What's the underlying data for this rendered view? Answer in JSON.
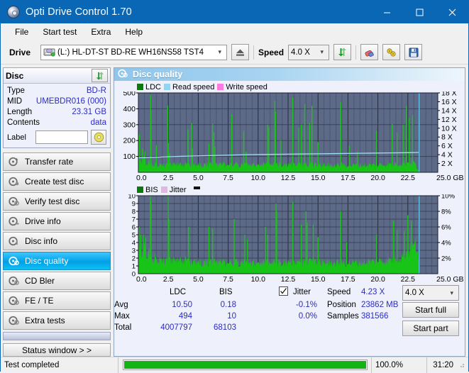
{
  "window": {
    "title": "Opti Drive Control 1.70",
    "icon": "disc-icon",
    "minimize": "—",
    "maximize": "☐",
    "close": "✕"
  },
  "menu": {
    "items": [
      "File",
      "Start test",
      "Extra",
      "Help"
    ]
  },
  "toolbar": {
    "drive_label": "Drive",
    "drive_value": "(L:)  HL-DT-ST BD-RE  WH16NS58 TST4",
    "eject_icon": "eject-icon",
    "speed_label": "Speed",
    "speed_value": "4.0 X",
    "refresh_icon": "refresh-icon",
    "erase_icon": "eraser-icon",
    "tools_icon": "tools-icon",
    "save_icon": "save-icon"
  },
  "disc": {
    "title": "Disc",
    "refresh_icon": "refresh-icon",
    "rows": [
      {
        "key": "Type",
        "value": "BD-R"
      },
      {
        "key": "MID",
        "value": "UMEBDR016 (000)"
      },
      {
        "key": "Length",
        "value": "23.31 GB"
      },
      {
        "key": "Contents",
        "value": "data"
      }
    ],
    "label_key": "Label",
    "label_value": "",
    "label_button_icon": "disc-label-icon"
  },
  "sidebar": {
    "items": [
      {
        "label": "Transfer rate",
        "icon": "disc-test-icon",
        "active": false
      },
      {
        "label": "Create test disc",
        "icon": "disc-test-icon",
        "active": false
      },
      {
        "label": "Verify test disc",
        "icon": "disc-test-icon",
        "active": false
      },
      {
        "label": "Drive info",
        "icon": "disc-test-icon",
        "active": false
      },
      {
        "label": "Disc info",
        "icon": "disc-test-icon",
        "active": false
      },
      {
        "label": "Disc quality",
        "icon": "disc-test-icon",
        "active": true
      },
      {
        "label": "CD Bler",
        "icon": "disc-test-icon",
        "active": false
      },
      {
        "label": "FE / TE",
        "icon": "disc-test-icon",
        "active": false
      },
      {
        "label": "Extra tests",
        "icon": "disc-test-icon",
        "active": false
      }
    ],
    "status_window_label": "Status window > >"
  },
  "panel": {
    "title": "Disc quality",
    "icon": "disc-quality-icon"
  },
  "stats": {
    "col_ldc": "LDC",
    "col_bis": "BIS",
    "jitter_label": "Jitter",
    "jitter_checked": true,
    "row_avg": "Avg",
    "row_max": "Max",
    "row_total": "Total",
    "ldc_avg": "10.50",
    "ldc_max": "494",
    "ldc_total": "4007797",
    "bis_avg": "0.18",
    "bis_max": "10",
    "bis_total": "68103",
    "jitter_avg": "-0.1%",
    "jitter_max": "0.0%",
    "speed_label": "Speed",
    "speed_value": "4.23 X",
    "position_label": "Position",
    "position_value": "23862 MB",
    "samples_label": "Samples",
    "samples_value": "381566",
    "speed_select": "4.0 X",
    "start_full": "Start full",
    "start_part": "Start part"
  },
  "statusbar": {
    "message": "Test completed",
    "percent": "100.0%",
    "progress": 100,
    "time": "31:20"
  },
  "chart_data": [
    {
      "type": "line",
      "name": "ldc-chart",
      "title": "",
      "xlabel": "GB",
      "ylabel": "",
      "x": [
        0.0,
        2.5,
        5.0,
        7.5,
        10.0,
        12.5,
        15.0,
        17.5,
        20.0,
        22.5,
        25.0
      ],
      "xlim": [
        0,
        25
      ],
      "ylim": [
        0,
        500
      ],
      "yticks": [
        100,
        200,
        300,
        400,
        500
      ],
      "y2lim": [
        0,
        18
      ],
      "y2ticks": [
        "2 X",
        "4 X",
        "6 X",
        "8 X",
        "10 X",
        "12 X",
        "14 X",
        "16 X",
        "18 X"
      ],
      "xtick_labels": [
        "0.0",
        "2.5",
        "5.0",
        "7.5",
        "10.0",
        "12.5",
        "15.0",
        "17.5",
        "20.0",
        "22.5",
        "25.0 GB"
      ],
      "grid": true,
      "legend": [
        {
          "label": "LDC",
          "color": "#0a7a0a"
        },
        {
          "label": "Read speed",
          "color": "#8fd6f5"
        },
        {
          "label": "Write speed",
          "color": "#ff7ae0"
        }
      ],
      "series": [
        {
          "name": "LDC",
          "color": "#19c419",
          "kind": "spike",
          "baseline_x": [
            0.0,
            0.6,
            1.2,
            2.0,
            3.0,
            4.0,
            5.0,
            6.0,
            7.0,
            8.0,
            9.0,
            10.0,
            11.0,
            12.0,
            13.0,
            14.0,
            15.0,
            16.0,
            17.0,
            18.0,
            19.0,
            20.0,
            21.0,
            22.0,
            23.0,
            23.5
          ],
          "baseline_y": [
            110,
            70,
            60,
            55,
            52,
            50,
            50,
            55,
            52,
            50,
            50,
            55,
            58,
            55,
            55,
            52,
            50,
            50,
            50,
            48,
            48,
            50,
            55,
            60,
            70,
            0
          ],
          "spikes": [
            {
              "x": 0.08,
              "y": 240
            },
            {
              "x": 0.35,
              "y": 150
            },
            {
              "x": 0.55,
              "y": 130
            },
            {
              "x": 1.02,
              "y": 490
            },
            {
              "x": 1.05,
              "y": 390
            },
            {
              "x": 1.5,
              "y": 170
            },
            {
              "x": 2.45,
              "y": 420
            },
            {
              "x": 2.5,
              "y": 185
            },
            {
              "x": 2.6,
              "y": 120
            },
            {
              "x": 4.15,
              "y": 270
            },
            {
              "x": 4.45,
              "y": 310
            },
            {
              "x": 4.5,
              "y": 150
            },
            {
              "x": 5.9,
              "y": 180
            },
            {
              "x": 6.2,
              "y": 305
            },
            {
              "x": 6.3,
              "y": 250
            },
            {
              "x": 6.4,
              "y": 160
            },
            {
              "x": 7.8,
              "y": 365
            },
            {
              "x": 8.8,
              "y": 260
            },
            {
              "x": 9.0,
              "y": 130
            },
            {
              "x": 10.8,
              "y": 300
            },
            {
              "x": 10.9,
              "y": 285
            },
            {
              "x": 11.4,
              "y": 450
            },
            {
              "x": 11.45,
              "y": 380
            },
            {
              "x": 11.9,
              "y": 200
            },
            {
              "x": 12.9,
              "y": 470
            },
            {
              "x": 13.4,
              "y": 280
            },
            {
              "x": 13.6,
              "y": 300
            },
            {
              "x": 13.9,
              "y": 430
            },
            {
              "x": 14.3,
              "y": 310
            },
            {
              "x": 14.5,
              "y": 420
            },
            {
              "x": 15.0,
              "y": 190
            },
            {
              "x": 16.9,
              "y": 440
            },
            {
              "x": 17.6,
              "y": 170
            },
            {
              "x": 18.3,
              "y": 130
            },
            {
              "x": 19.9,
              "y": 260
            },
            {
              "x": 21.2,
              "y": 305
            },
            {
              "x": 21.6,
              "y": 250
            },
            {
              "x": 22.1,
              "y": 300
            },
            {
              "x": 22.4,
              "y": 420
            },
            {
              "x": 22.6,
              "y": 340
            },
            {
              "x": 22.9,
              "y": 360
            }
          ]
        },
        {
          "name": "Read speed",
          "color": "#9fdcf7",
          "kind": "line",
          "x": [
            0.0,
            1.5,
            2.0,
            3.2,
            4.5,
            6.0,
            7.5,
            9.0,
            10.5,
            12.0,
            13.5,
            15.0,
            16.5,
            18.0,
            19.5,
            21.0,
            22.5,
            23.4
          ],
          "y": [
            3.3,
            3.4,
            3.5,
            3.6,
            3.7,
            3.8,
            3.9,
            4.0,
            4.05,
            4.1,
            4.15,
            4.2,
            4.25,
            4.3,
            4.35,
            4.4,
            4.45,
            4.5
          ]
        },
        {
          "name": "end-marker",
          "color": "#5ec8f0",
          "kind": "vline",
          "x": 23.45
        }
      ]
    },
    {
      "type": "bar",
      "name": "bis-chart",
      "title": "",
      "xlabel": "GB",
      "ylabel": "",
      "xlim": [
        0,
        25
      ],
      "ylim": [
        0,
        10
      ],
      "yticks": [
        1,
        2,
        3,
        4,
        5,
        6,
        7,
        8,
        9,
        10
      ],
      "y2ticks": [
        "2%",
        "4%",
        "6%",
        "8%",
        "10%"
      ],
      "xtick_labels": [
        "0.0",
        "2.5",
        "5.0",
        "7.5",
        "10.0",
        "12.5",
        "15.0",
        "17.5",
        "20.0",
        "22.5",
        "25.0 GB"
      ],
      "grid": true,
      "legend": [
        {
          "label": "BIS",
          "color": "#0a7a0a"
        },
        {
          "label": "Jitter",
          "color": "#e2b6e2"
        }
      ],
      "series": [
        {
          "name": "BIS",
          "color": "#19c419",
          "kind": "spike",
          "baseline_x": [
            0.0,
            0.4,
            0.9,
            1.4,
            2.2,
            3.0,
            4.0,
            5.0,
            6.0,
            7.0,
            8.0,
            9.0,
            10.0,
            11.0,
            12.0,
            13.0,
            14.0,
            15.0,
            16.0,
            17.0,
            18.0,
            19.0,
            20.0,
            21.0,
            22.0,
            22.8,
            23.3,
            23.45
          ],
          "baseline_y": [
            3.8,
            3.2,
            2.6,
            2.2,
            2.0,
            1.8,
            1.7,
            1.6,
            1.6,
            1.5,
            1.5,
            1.5,
            1.6,
            1.6,
            1.6,
            1.6,
            1.6,
            1.6,
            1.6,
            1.5,
            1.5,
            1.6,
            1.7,
            1.9,
            2.3,
            3.5,
            4.0,
            0
          ],
          "spikes": [
            {
              "x": 0.05,
              "y": 6.0
            },
            {
              "x": 0.2,
              "y": 5.0
            },
            {
              "x": 0.45,
              "y": 5.0
            },
            {
              "x": 0.6,
              "y": 4.6
            },
            {
              "x": 1.0,
              "y": 10.0
            },
            {
              "x": 1.05,
              "y": 9.3
            },
            {
              "x": 2.5,
              "y": 10.0
            },
            {
              "x": 2.55,
              "y": 7.0
            },
            {
              "x": 4.2,
              "y": 6.0
            },
            {
              "x": 5.9,
              "y": 6.0
            },
            {
              "x": 6.2,
              "y": 5.8
            },
            {
              "x": 8.0,
              "y": 7.0
            },
            {
              "x": 8.9,
              "y": 5.0
            },
            {
              "x": 9.1,
              "y": 4.4
            },
            {
              "x": 10.6,
              "y": 6.0
            },
            {
              "x": 10.8,
              "y": 5.0
            },
            {
              "x": 11.5,
              "y": 9.0
            },
            {
              "x": 11.55,
              "y": 8.0
            },
            {
              "x": 12.9,
              "y": 9.2
            },
            {
              "x": 13.6,
              "y": 6.3
            },
            {
              "x": 14.0,
              "y": 8.0
            },
            {
              "x": 14.1,
              "y": 6.5
            },
            {
              "x": 14.6,
              "y": 6.3
            },
            {
              "x": 15.0,
              "y": 4.7
            },
            {
              "x": 16.9,
              "y": 8.0
            },
            {
              "x": 17.4,
              "y": 4.0
            },
            {
              "x": 19.9,
              "y": 5.0
            },
            {
              "x": 21.3,
              "y": 6.8
            },
            {
              "x": 21.6,
              "y": 5.6
            },
            {
              "x": 22.2,
              "y": 5.5
            },
            {
              "x": 22.5,
              "y": 7.5
            },
            {
              "x": 22.8,
              "y": 6.8
            },
            {
              "x": 23.1,
              "y": 4.2
            }
          ]
        },
        {
          "name": "end-marker",
          "color": "#5ec8f0",
          "kind": "vline",
          "x": 23.45
        }
      ]
    }
  ]
}
